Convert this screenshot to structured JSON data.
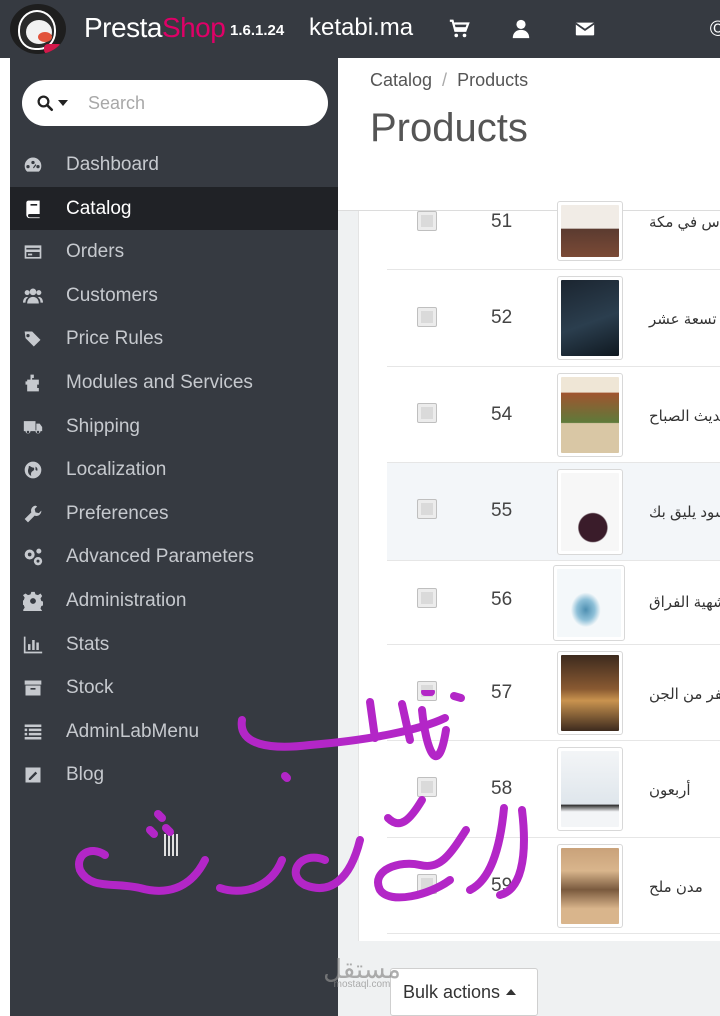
{
  "header": {
    "brand_part1": "Presta",
    "brand_part2": "Shop",
    "version": "1.6.1.24",
    "shop_name": "ketabi.ma",
    "icons": [
      "cart-icon",
      "user-icon",
      "envelope-icon"
    ],
    "brand_color": "#df0067",
    "background": "#363a41"
  },
  "search": {
    "placeholder": "Search"
  },
  "sidebar": {
    "items": [
      {
        "label": "Dashboard",
        "icon": "dashboard-icon"
      },
      {
        "label": "Catalog",
        "icon": "book-icon",
        "active": true
      },
      {
        "label": "Orders",
        "icon": "credit-card-icon"
      },
      {
        "label": "Customers",
        "icon": "users-icon"
      },
      {
        "label": "Price Rules",
        "icon": "tags-icon"
      },
      {
        "label": "Modules and Services",
        "icon": "puzzle-icon"
      },
      {
        "label": "Shipping",
        "icon": "truck-icon"
      },
      {
        "label": "Localization",
        "icon": "globe-icon"
      },
      {
        "label": "Preferences",
        "icon": "wrench-icon"
      },
      {
        "label": "Advanced Parameters",
        "icon": "cogs-icon"
      },
      {
        "label": "Administration",
        "icon": "cog-icon"
      },
      {
        "label": "Stats",
        "icon": "bar-chart-icon"
      },
      {
        "label": "Stock",
        "icon": "archive-icon"
      },
      {
        "label": "AdminLabMenu",
        "icon": "list-icon"
      },
      {
        "label": "Blog",
        "icon": "edit-icon"
      }
    ]
  },
  "breadcrumb": {
    "parent": "Catalog",
    "separator": "/",
    "current": "Products"
  },
  "page": {
    "title": "Products"
  },
  "products": [
    {
      "id": "51",
      "name": "ناس في مكة",
      "cover_color": "#6b4a3a"
    },
    {
      "id": "52",
      "name": "تسعة عشر",
      "cover_color": "#1f2a33"
    },
    {
      "id": "54",
      "name": "حديث الصباح",
      "cover_color": "#b8a27a"
    },
    {
      "id": "55",
      "name": "أسود يليق بك",
      "cover_color": "#f4f4f4"
    },
    {
      "id": "56",
      "name": "شهية الفراق",
      "cover_color": "#e9f0f3"
    },
    {
      "id": "57",
      "name": "نفر من الجن",
      "cover_color": "#6e4a2f"
    },
    {
      "id": "58",
      "name": "أربعون",
      "cover_color": "#eef1f4"
    },
    {
      "id": "59",
      "name": "مدن ملح",
      "cover_color": "#c49a6c"
    }
  ],
  "bulk_actions": {
    "label": "Bulk actions"
  },
  "overlay": {
    "handwriting_text": "زينب للخدمات",
    "handwriting_color": "#b326c7",
    "watermark_ar": "مستقل",
    "watermark_en": "mostaql.com"
  }
}
